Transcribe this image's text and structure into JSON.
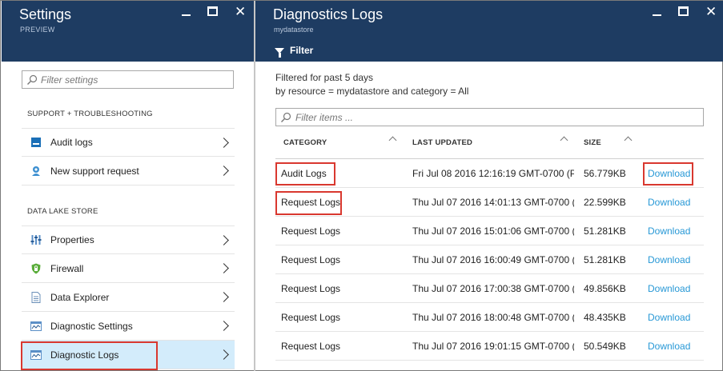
{
  "settings_blade": {
    "title": "Settings",
    "subtitle": "PREVIEW",
    "search_placeholder": "Filter settings",
    "sections": [
      {
        "header": "SUPPORT + TROUBLESHOOTING",
        "items": [
          {
            "label": "Audit logs",
            "icon": "audit-logs-icon"
          },
          {
            "label": "New support request",
            "icon": "support-icon"
          }
        ]
      },
      {
        "header": "DATA LAKE STORE",
        "items": [
          {
            "label": "Properties",
            "icon": "properties-icon"
          },
          {
            "label": "Firewall",
            "icon": "firewall-shield-icon"
          },
          {
            "label": "Data Explorer",
            "icon": "document-icon"
          },
          {
            "label": "Diagnostic Settings",
            "icon": "diagnostic-settings-icon"
          },
          {
            "label": "Diagnostic Logs",
            "icon": "diagnostic-logs-icon",
            "selected": true
          }
        ]
      }
    ]
  },
  "logs_blade": {
    "title": "Diagnostics Logs",
    "subtitle": "mydatastore",
    "filter_label": "Filter",
    "filter_line1": "Filtered for past 5 days",
    "filter_line2": "by resource = mydatastore and category = All",
    "search_placeholder": "Filter items ...",
    "columns": [
      "CATEGORY",
      "LAST UPDATED",
      "SIZE"
    ],
    "rows": [
      {
        "category": "Audit Logs",
        "updated": "Fri Jul 08 2016 12:16:19 GMT-0700 (P...",
        "size": "56.779KB",
        "action": "Download"
      },
      {
        "category": "Request Logs",
        "updated": "Thu Jul 07 2016 14:01:13 GMT-0700 (...",
        "size": "22.599KB",
        "action": "Download"
      },
      {
        "category": "Request Logs",
        "updated": "Thu Jul 07 2016 15:01:06 GMT-0700 (...",
        "size": "51.281KB",
        "action": "Download"
      },
      {
        "category": "Request Logs",
        "updated": "Thu Jul 07 2016 16:00:49 GMT-0700 (...",
        "size": "51.281KB",
        "action": "Download"
      },
      {
        "category": "Request Logs",
        "updated": "Thu Jul 07 2016 17:00:38 GMT-0700 (...",
        "size": "49.856KB",
        "action": "Download"
      },
      {
        "category": "Request Logs",
        "updated": "Thu Jul 07 2016 18:00:48 GMT-0700 (...",
        "size": "48.435KB",
        "action": "Download"
      },
      {
        "category": "Request Logs",
        "updated": "Thu Jul 07 2016 19:01:15 GMT-0700 (...",
        "size": "50.549KB",
        "action": "Download"
      }
    ]
  },
  "colors": {
    "header_bg": "#1e3c62",
    "link": "#2798d6",
    "highlight": "#d9382f",
    "selected_bg": "#d3ecfb"
  }
}
